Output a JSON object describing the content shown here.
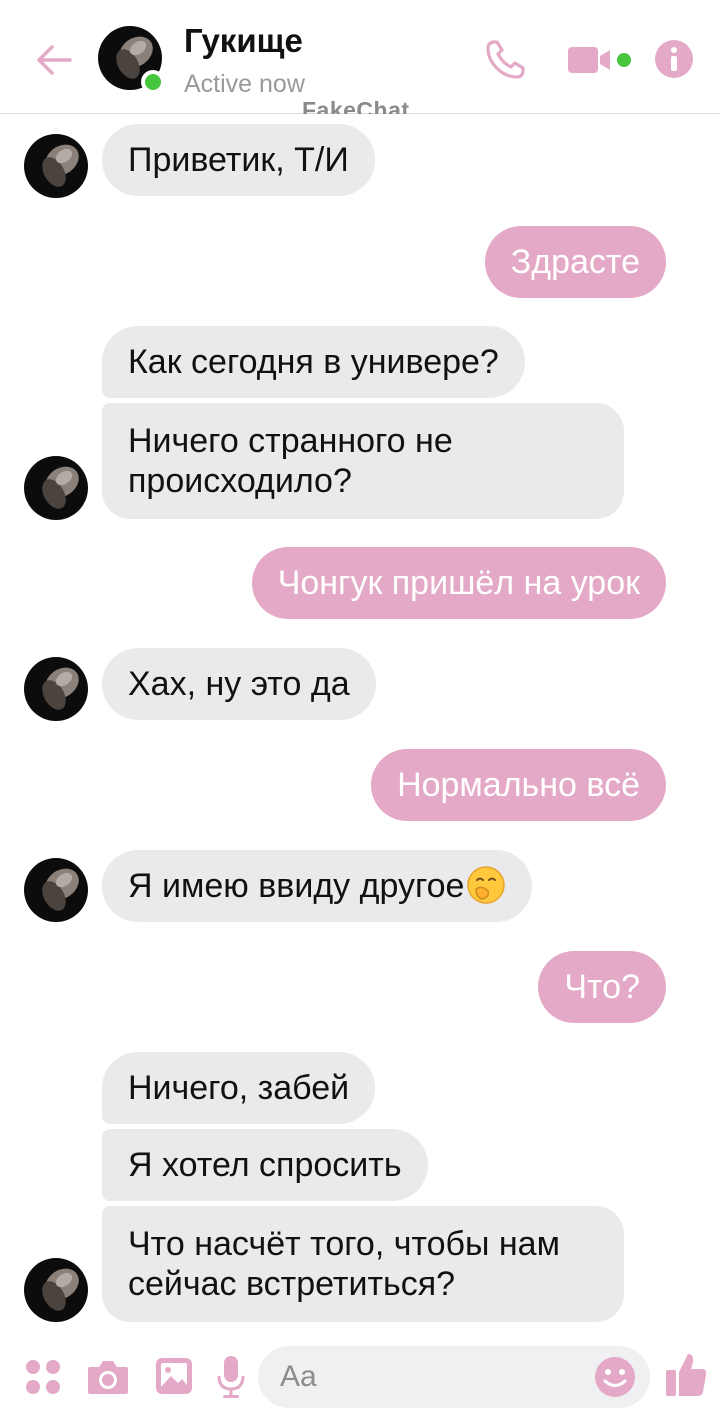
{
  "header": {
    "name": "Гукище",
    "status": "Active now",
    "watermark": "FakeChat"
  },
  "theme": {
    "accent": "#e3a9c6",
    "incoming_bg": "#eaeaed",
    "online": "#46c63d"
  },
  "icons": [
    "back-arrow-icon",
    "phone-icon",
    "video-icon",
    "info-icon",
    "apps-icon",
    "camera-icon",
    "image-icon",
    "microphone-icon",
    "emoji-icon",
    "thumbs-up-icon"
  ],
  "messages": [
    {
      "from": "contact",
      "text": "Приветик, Т/И"
    },
    {
      "from": "me",
      "text": "Здрасте"
    },
    {
      "from": "contact",
      "text": "Как сегодня в универе?"
    },
    {
      "from": "contact",
      "text": "Ничего странного не происходило?"
    },
    {
      "from": "me",
      "text": "Чонгук пришёл на урок"
    },
    {
      "from": "contact",
      "text": "Хах, ну это да"
    },
    {
      "from": "me",
      "text": "Нормально всё"
    },
    {
      "from": "contact",
      "text": "Я имею ввиду другое"
    },
    {
      "from": "me",
      "text": "Что?"
    },
    {
      "from": "contact",
      "text": "Ничего, забей"
    },
    {
      "from": "contact",
      "text": "Я хотел спросить"
    },
    {
      "from": "contact",
      "text": "Что насчёт того, чтобы нам сейчас встретиться?"
    }
  ],
  "composer": {
    "placeholder": "Aa"
  }
}
